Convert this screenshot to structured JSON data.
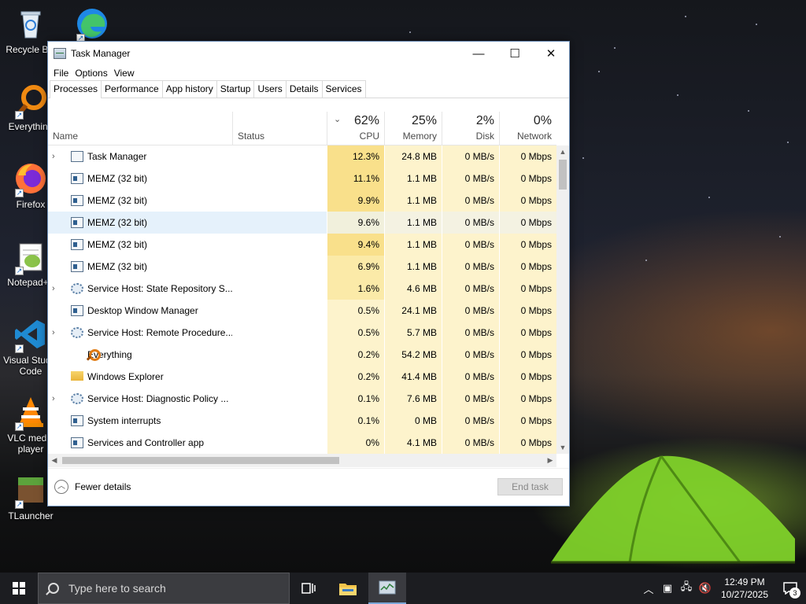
{
  "desktop": {
    "icons": [
      {
        "label": "Recycle Bin",
        "icon": "recycle-bin-icon"
      },
      {
        "label": "Everything",
        "icon": "everything-icon"
      },
      {
        "label": "Firefox",
        "icon": "firefox-icon"
      },
      {
        "label": "Notepad++",
        "icon": "notepad-plus-plus-icon"
      },
      {
        "label": "Visual Studio Code",
        "icon": "vscode-icon"
      },
      {
        "label": "VLC media player",
        "icon": "vlc-icon"
      },
      {
        "label": "TLauncher",
        "icon": "tlauncher-icon"
      }
    ],
    "extra_icon": "edge-icon"
  },
  "window": {
    "title": "Task Manager",
    "controls": {
      "minimize": "—",
      "maximize": "☐",
      "close": "✕"
    },
    "menu": [
      "File",
      "Options",
      "View"
    ],
    "tabs": [
      "Processes",
      "Performance",
      "App history",
      "Startup",
      "Users",
      "Details",
      "Services"
    ],
    "active_tab": "Processes"
  },
  "table": {
    "columns": {
      "name": "Name",
      "status": "Status",
      "cpu": {
        "label": "CPU",
        "total": "62%"
      },
      "memory": {
        "label": "Memory",
        "total": "25%"
      },
      "disk": {
        "label": "Disk",
        "total": "2%"
      },
      "network": {
        "label": "Network",
        "total": "0%"
      }
    },
    "rows": [
      {
        "expandable": true,
        "icon": "task-manager",
        "name": "Task Manager",
        "cpu": "12.3%",
        "memory": "24.8 MB",
        "disk": "0 MB/s",
        "network": "0 Mbps"
      },
      {
        "expandable": false,
        "icon": "memz",
        "name": "MEMZ (32 bit)",
        "cpu": "11.1%",
        "memory": "1.1 MB",
        "disk": "0 MB/s",
        "network": "0 Mbps"
      },
      {
        "expandable": false,
        "icon": "memz",
        "name": "MEMZ (32 bit)",
        "cpu": "9.9%",
        "memory": "1.1 MB",
        "disk": "0 MB/s",
        "network": "0 Mbps"
      },
      {
        "expandable": false,
        "icon": "memz",
        "name": "MEMZ (32 bit)",
        "cpu": "9.6%",
        "memory": "1.1 MB",
        "disk": "0 MB/s",
        "network": "0 Mbps",
        "selected": true
      },
      {
        "expandable": false,
        "icon": "memz",
        "name": "MEMZ (32 bit)",
        "cpu": "9.4%",
        "memory": "1.1 MB",
        "disk": "0 MB/s",
        "network": "0 Mbps"
      },
      {
        "expandable": false,
        "icon": "memz",
        "name": "MEMZ (32 bit)",
        "cpu": "6.9%",
        "memory": "1.1 MB",
        "disk": "0 MB/s",
        "network": "0 Mbps"
      },
      {
        "expandable": true,
        "icon": "gear",
        "name": "Service Host: State Repository S...",
        "cpu": "1.6%",
        "memory": "4.6 MB",
        "disk": "0 MB/s",
        "network": "0 Mbps"
      },
      {
        "expandable": false,
        "icon": "memz",
        "name": "Desktop Window Manager",
        "cpu": "0.5%",
        "memory": "24.1 MB",
        "disk": "0 MB/s",
        "network": "0 Mbps"
      },
      {
        "expandable": true,
        "icon": "gear",
        "name": "Service Host: Remote Procedure...",
        "cpu": "0.5%",
        "memory": "5.7 MB",
        "disk": "0 MB/s",
        "network": "0 Mbps"
      },
      {
        "expandable": false,
        "icon": "search",
        "name": "Everything",
        "cpu": "0.2%",
        "memory": "54.2 MB",
        "disk": "0 MB/s",
        "network": "0 Mbps"
      },
      {
        "expandable": false,
        "icon": "folder",
        "name": "Windows Explorer",
        "cpu": "0.2%",
        "memory": "41.4 MB",
        "disk": "0 MB/s",
        "network": "0 Mbps"
      },
      {
        "expandable": true,
        "icon": "gear",
        "name": "Service Host: Diagnostic Policy ...",
        "cpu": "0.1%",
        "memory": "7.6 MB",
        "disk": "0 MB/s",
        "network": "0 Mbps"
      },
      {
        "expandable": false,
        "icon": "memz",
        "name": "System interrupts",
        "cpu": "0.1%",
        "memory": "0 MB",
        "disk": "0 MB/s",
        "network": "0 Mbps"
      },
      {
        "expandable": false,
        "icon": "memz",
        "name": "Services and Controller app",
        "cpu": "0%",
        "memory": "4.1 MB",
        "disk": "0 MB/s",
        "network": "0 Mbps"
      }
    ]
  },
  "footer": {
    "fewer_details": "Fewer details",
    "end_task": "End task"
  },
  "taskbar": {
    "search_placeholder": "Type here to search",
    "time": "12:49 PM",
    "date": "10/27/2025",
    "notification_count": "3"
  },
  "colors": {
    "heat_high": "#f9e08b",
    "heat_mid": "#fbeaa8",
    "heat_low": "#fdf3cc",
    "selected_row": "#e5f1fb",
    "taskbar": "#1c1d21"
  }
}
